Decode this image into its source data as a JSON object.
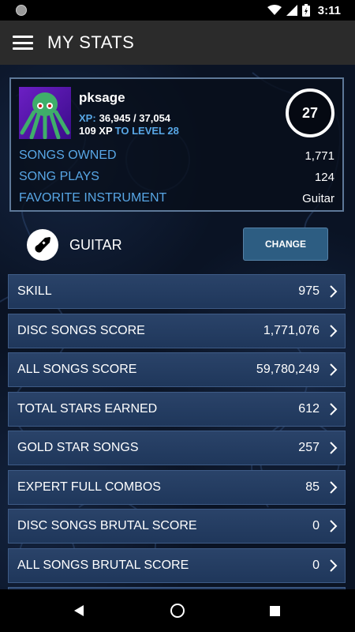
{
  "status_bar": {
    "time": "3:11"
  },
  "app_bar": {
    "title": "MY STATS",
    "menu_icon": "hamburger-menu-icon"
  },
  "profile": {
    "username": "pksage",
    "xp_label": "XP:",
    "xp_value": "36,945 / 37,054",
    "xp_to_next": "109 XP",
    "level_suffix": "TO LEVEL 28",
    "level": "27",
    "stats": [
      {
        "label": "SONGS OWNED",
        "value": "1,771"
      },
      {
        "label": "SONG PLAYS",
        "value": "124"
      },
      {
        "label": "FAVORITE INSTRUMENT",
        "value": "Guitar"
      }
    ]
  },
  "instrument": {
    "name": "GUITAR",
    "change_label": "CHANGE"
  },
  "stat_rows": [
    {
      "label": "SKILL",
      "value": "975"
    },
    {
      "label": "DISC SONGS SCORE",
      "value": "1,771,076"
    },
    {
      "label": "ALL SONGS SCORE",
      "value": "59,780,249"
    },
    {
      "label": "TOTAL STARS EARNED",
      "value": "612"
    },
    {
      "label": "GOLD STAR SONGS",
      "value": "257"
    },
    {
      "label": "EXPERT FULL COMBOS",
      "value": "85"
    },
    {
      "label": "DISC SONGS BRUTAL SCORE",
      "value": "0"
    },
    {
      "label": "ALL SONGS BRUTAL SCORE",
      "value": "0"
    }
  ],
  "colors": {
    "accent": "#58a7e6",
    "row_bg": "#24406a",
    "button_bg": "#2d5d82"
  }
}
